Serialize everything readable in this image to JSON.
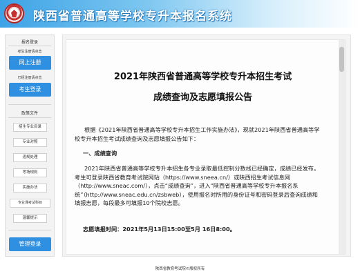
{
  "header": {
    "title": "陕西省普通高等学校专升本报名系统",
    "logo": "shaanxi-exam-logo"
  },
  "sidebar": {
    "section_login": "报名登录",
    "hint_register": "考生注册请点击",
    "register_button": "网上注册",
    "hint_login": "已经注册请点击",
    "login_button": "考生登录",
    "section_policy": "政策文件",
    "policy_items": [
      "招生专业目录",
      "专业对照",
      "违规处理",
      "考场规则",
      "实施办法",
      "专业课考试科目",
      "温馨提示"
    ],
    "admin_button": "管理登录"
  },
  "document": {
    "title_line1": "2021年陕西省普通高等学校专升本招生考试",
    "title_line2": "成绩查询及志愿填报公告",
    "intro": "根据《2021年陕西省普通高等学校专升本招生工作实施办法》，现就2021年陕西省普通高等学校专升本招生考试成绩查询及志愿填报公告如下：",
    "section1_heading": "一、成绩查询",
    "section1_body": "2021年陕西省普通高等学校专升本招生各专业录取最低控制分数线已经确定，成绩已经发布。考生可登录陕西省教育考试院网站（https://www.sneea.cn/）或陕西招生考试信息网（http://www.sneac.com/），点击“成绩查询”，进入“陕西省普通高等学校专升本报名系统”（http://www.sneac.edu.cn/zsbweb），使用报名时所用的身份证号和密码登录后查询成绩和填报志愿，每段最多可填报10个院校志愿。",
    "deadline_label": "志愿填报时间：",
    "deadline_value": "2021年5月13日15:00至5月 16日8:00。"
  },
  "footer": {
    "copyright": "陕西省教育考试院©版权所有"
  },
  "colors": {
    "accent": "#2f8fe0",
    "header_start": "#3da3e6"
  }
}
